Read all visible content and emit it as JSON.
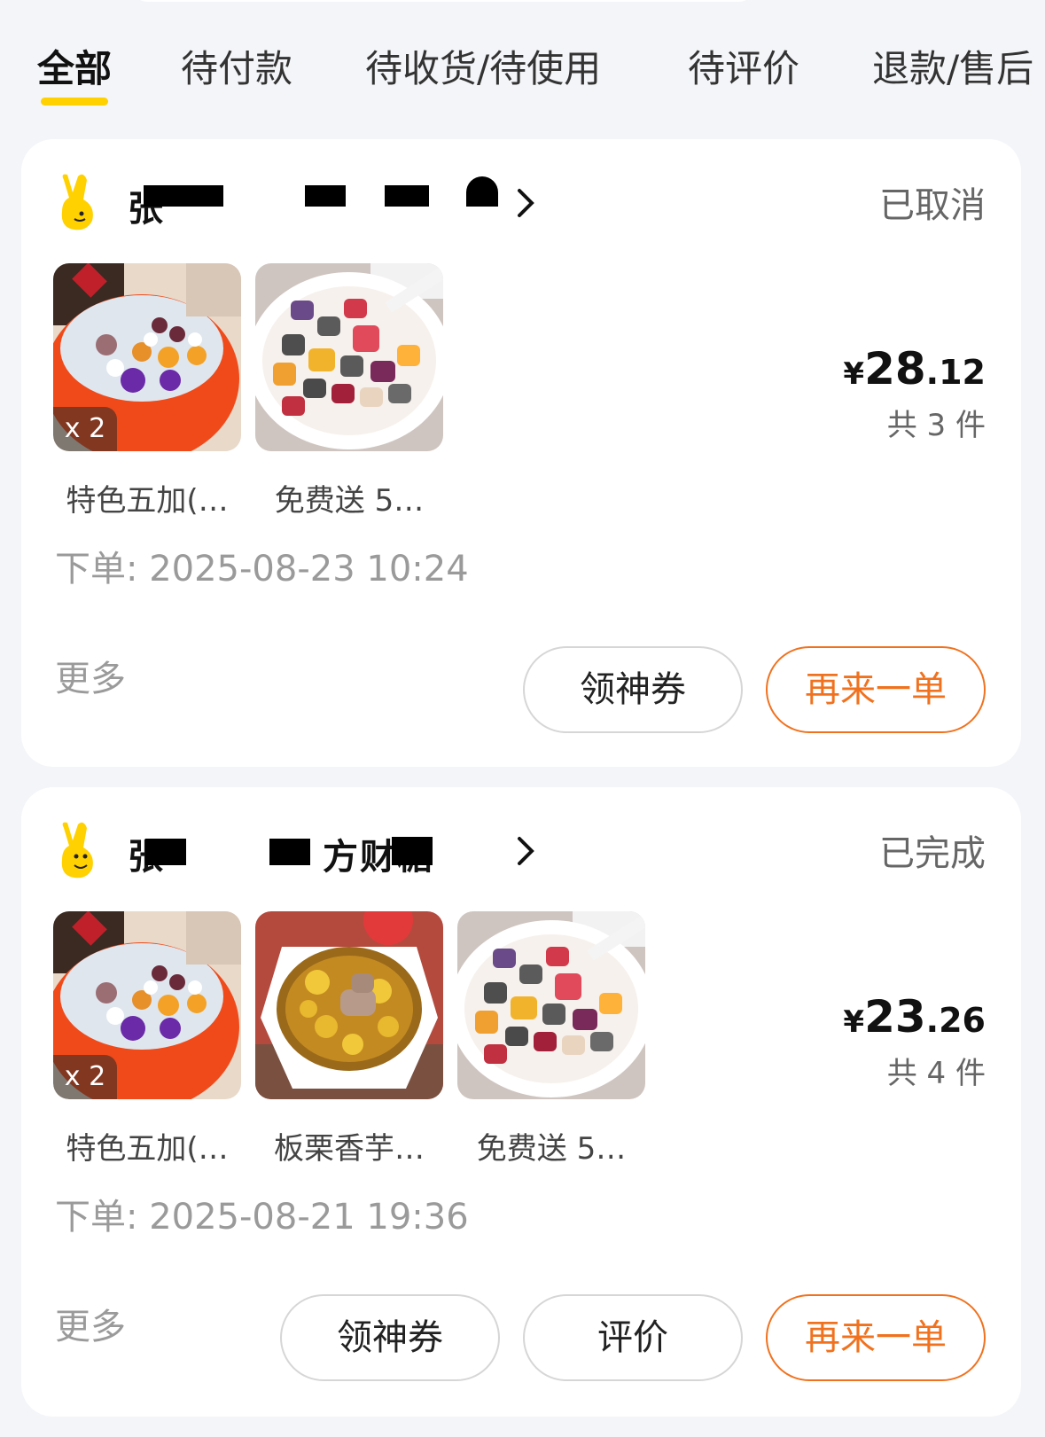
{
  "tabs": [
    "全部",
    "待付款",
    "待收货/待使用",
    "待评价",
    "退款/售后"
  ],
  "colors": {
    "accent": "#ffd100",
    "primary_button": "#f0721f"
  },
  "orders": [
    {
      "shop_name": "张",
      "status": "已取消",
      "items": [
        {
          "name": "特色五加(…",
          "quantity": "x 2"
        },
        {
          "name": "免费送 5…"
        }
      ],
      "price_symbol": "¥",
      "price_int": "28",
      "price_dec": ".12",
      "count": "共 3 件",
      "order_time": "下单: 2025-08-23 10:24",
      "more": "更多",
      "buttons": [
        "领神券",
        "再来一单"
      ]
    },
    {
      "shop_name": "张",
      "shop_name_visible": "方财糖",
      "status": "已完成",
      "items": [
        {
          "name": "特色五加(…",
          "quantity": "x 2"
        },
        {
          "name": "板栗香芋…"
        },
        {
          "name": "免费送 5…"
        }
      ],
      "price_symbol": "¥",
      "price_int": "23",
      "price_dec": ".26",
      "count": "共 4 件",
      "order_time": "下单: 2025-08-21 19:36",
      "more": "更多",
      "buttons": [
        "领神券",
        "评价",
        "再来一单"
      ]
    }
  ]
}
